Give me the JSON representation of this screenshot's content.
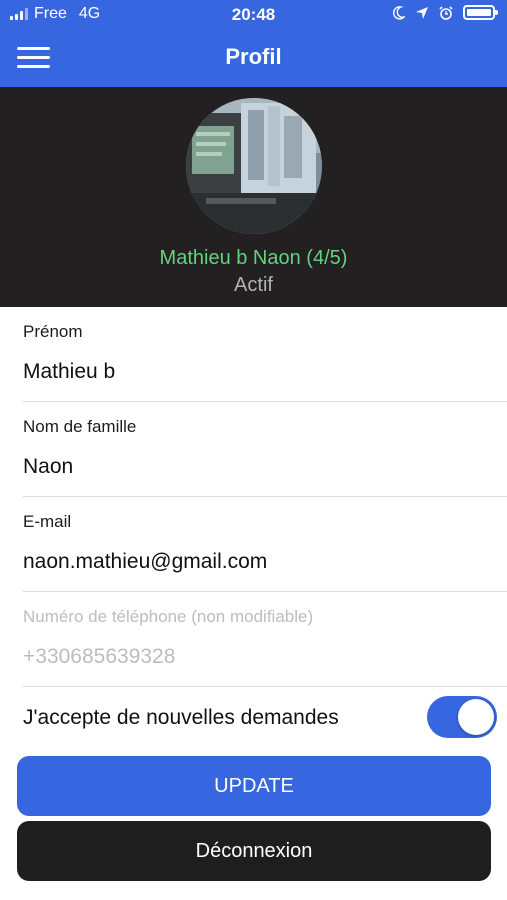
{
  "status_bar": {
    "carrier": "Free",
    "network": "4G",
    "time": "20:48",
    "icons": [
      "moon-icon",
      "location-icon",
      "alarm-icon",
      "battery-icon"
    ]
  },
  "nav": {
    "title": "Profil",
    "menu_icon": "hamburger-icon"
  },
  "profile": {
    "name": "Mathieu b Naon (4/5)",
    "status": "Actif"
  },
  "fields": [
    {
      "label": "Prénom",
      "value": "Mathieu b"
    },
    {
      "label": "Nom de famille",
      "value": "Naon"
    },
    {
      "label": "E-mail",
      "value": "naon.mathieu@gmail.com"
    },
    {
      "label": "Numéro de téléphone (non modifiable)",
      "value": "+330685639328"
    }
  ],
  "toggle": {
    "label": "J'accepte de nouvelles demandes",
    "checked": true
  },
  "buttons": {
    "update": "UPDATE",
    "logout": "Déconnexion"
  },
  "colors": {
    "primary": "#3767e0",
    "header_bg": "#222020",
    "name_green": "#63d27f",
    "logout_bg": "#1e1e1e"
  }
}
